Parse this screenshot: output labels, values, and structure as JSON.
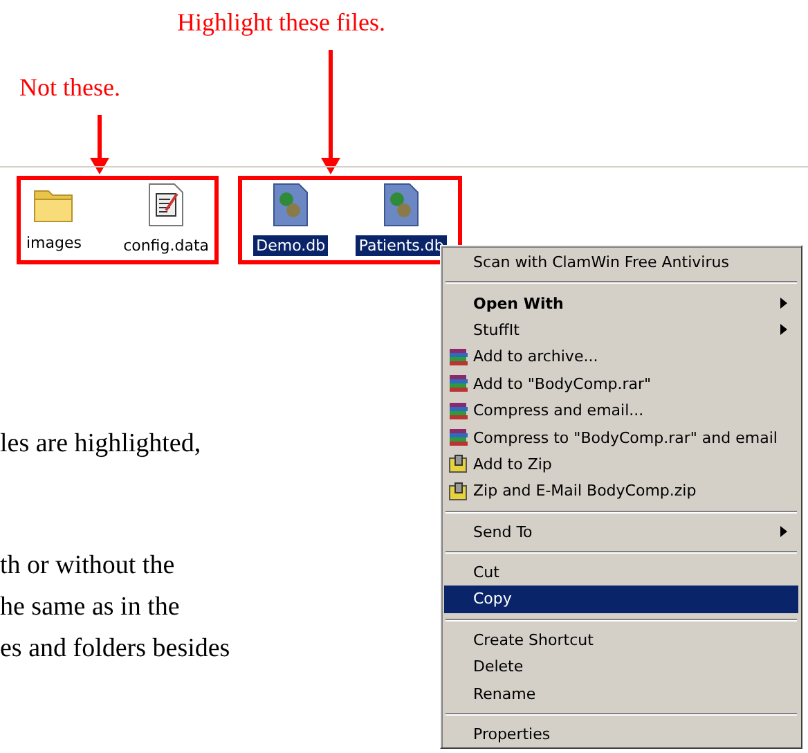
{
  "callouts": [
    {
      "text": "Highlight these files."
    },
    {
      "text": "Not these."
    }
  ],
  "files": [
    {
      "name": "images",
      "kind": "folder",
      "selected": false
    },
    {
      "name": "config.data",
      "kind": "document",
      "selected": false
    },
    {
      "name": "Demo.db",
      "kind": "database",
      "selected": true
    },
    {
      "name": "Patients.db",
      "kind": "database",
      "selected": true
    }
  ],
  "body_text": [
    [
      "les are highlighted,"
    ],
    [
      "th or without the",
      "he same as in the",
      "es and folders besides"
    ]
  ],
  "context_menu": [
    {
      "kind": "item",
      "label": "Scan with ClamWin Free Antivirus",
      "bold": false,
      "submenu": false,
      "selected": false
    },
    {
      "kind": "separator"
    },
    {
      "kind": "item",
      "label": "Open With",
      "bold": true,
      "submenu": true,
      "selected": false
    },
    {
      "kind": "item",
      "label": "StuffIt",
      "bold": false,
      "submenu": true,
      "selected": false
    },
    {
      "kind": "archive",
      "label": "Add to archive...",
      "bold": false,
      "submenu": false,
      "selected": false
    },
    {
      "kind": "archive",
      "label": "Add to \"BodyComp.rar\"",
      "bold": false,
      "submenu": false,
      "selected": false
    },
    {
      "kind": "archive",
      "label": "Compress and email...",
      "bold": false,
      "submenu": false,
      "selected": false
    },
    {
      "kind": "archive",
      "label": "Compress to \"BodyComp.rar\" and email",
      "bold": false,
      "submenu": false,
      "selected": false
    },
    {
      "kind": "zip",
      "label": "Add to Zip",
      "bold": false,
      "submenu": false,
      "selected": false
    },
    {
      "kind": "zip",
      "label": "Zip and E-Mail BodyComp.zip",
      "bold": false,
      "submenu": false,
      "selected": false
    },
    {
      "kind": "separator"
    },
    {
      "kind": "item",
      "label": "Send To",
      "bold": false,
      "submenu": true,
      "selected": false
    },
    {
      "kind": "separator"
    },
    {
      "kind": "item",
      "label": "Cut",
      "bold": false,
      "submenu": false,
      "selected": false
    },
    {
      "kind": "item",
      "label": "Copy",
      "bold": false,
      "submenu": false,
      "selected": true
    },
    {
      "kind": "separator"
    },
    {
      "kind": "item",
      "label": "Create Shortcut",
      "bold": false,
      "submenu": false,
      "selected": false
    },
    {
      "kind": "item",
      "label": "Delete",
      "bold": false,
      "submenu": false,
      "selected": false
    },
    {
      "kind": "item",
      "label": "Rename",
      "bold": false,
      "submenu": false,
      "selected": false
    },
    {
      "kind": "separator"
    },
    {
      "kind": "item",
      "label": "Properties",
      "bold": false,
      "submenu": false,
      "selected": false
    }
  ]
}
